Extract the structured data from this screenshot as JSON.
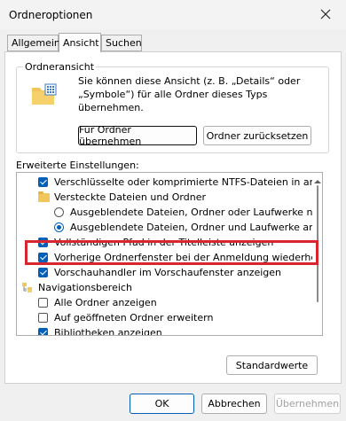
{
  "window": {
    "title": "Ordneroptionen"
  },
  "tabs": [
    {
      "label": "Allgemein"
    },
    {
      "label": "Ansicht"
    },
    {
      "label": "Suchen"
    }
  ],
  "folder_view": {
    "group_label": "Ordneransicht",
    "description": "Sie können diese Ansicht (z. B. „Details“ oder „Symbole“) für alle Ordner dieses Typs übernehmen.",
    "apply_button": "Für Ordner übernehmen",
    "reset_button": "Ordner zurücksetzen"
  },
  "advanced": {
    "label": "Erweiterte Einstellungen:",
    "items": [
      {
        "type": "checkbox",
        "checked": true,
        "label": "Verschlüsselte oder komprimierte NTFS-Dateien in anderer"
      },
      {
        "type": "folder",
        "label": "Versteckte Dateien und Ordner"
      },
      {
        "type": "radio",
        "checked": false,
        "label": "Ausgeblendete Dateien, Ordner oder Laufwerke nicht a"
      },
      {
        "type": "radio",
        "checked": true,
        "label": "Ausgeblendete Dateien, Ordner und Laufwerke anzeig"
      },
      {
        "type": "checkbox",
        "checked": true,
        "label": "Vollständigen Pfad in der Titelleiste anzeigen"
      },
      {
        "type": "checkbox",
        "checked": true,
        "label": "Vorherige Ordnerfenster bei der Anmeldung wiederherstellen"
      },
      {
        "type": "checkbox",
        "checked": true,
        "label": "Vorschauhandler im Vorschaufenster anzeigen"
      },
      {
        "type": "navfolder",
        "label": "Navigationsbereich"
      },
      {
        "type": "checkbox",
        "checked": false,
        "label": "Alle Ordner anzeigen"
      },
      {
        "type": "checkbox",
        "checked": false,
        "label": "Auf geöffneten Ordner erweitern"
      },
      {
        "type": "checkbox",
        "checked": true,
        "label": "Bibliotheken anzeigen"
      }
    ]
  },
  "defaults_button": "Standardwerte",
  "footer": {
    "ok": "OK",
    "cancel": "Abbrechen",
    "apply": "Übernehmen"
  },
  "colors": {
    "accent": "#005fb8",
    "highlight": "#d8262e"
  }
}
